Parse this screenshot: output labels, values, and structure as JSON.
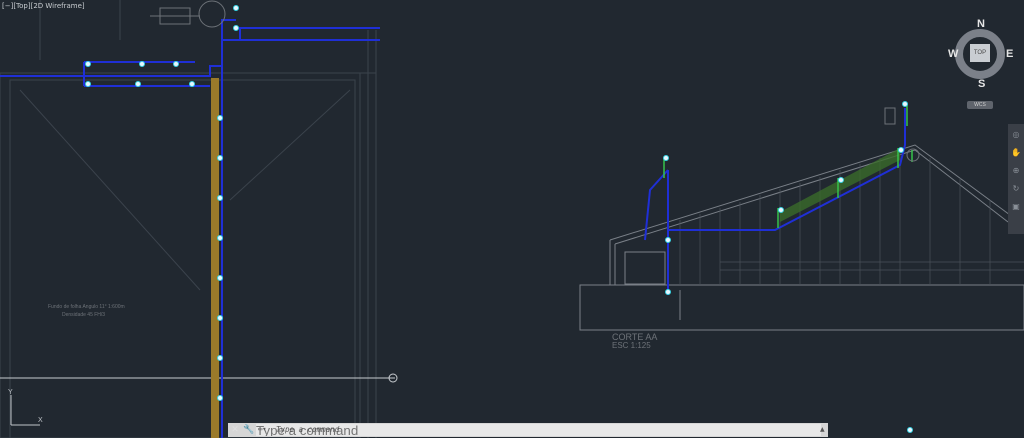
{
  "viewport": {
    "label": "[−][Top][2D Wireframe]"
  },
  "viewcube": {
    "north": "N",
    "south": "S",
    "east": "E",
    "west": "W",
    "face": "TOP",
    "ucs_menu": "WCS"
  },
  "ucs": {
    "x": "X",
    "y": "Y"
  },
  "drawing": {
    "section_title": "CORTE AA",
    "section_scale": "ESC 1:125",
    "note_line1": "Fundo de folha  Angulo 11°  1:600m",
    "note_line2": "Densidade 45 FH/3"
  },
  "command_line": {
    "close_icon": "close-icon",
    "customize_icon": "wrench-icon",
    "placeholder": "Type a command"
  },
  "colors": {
    "background": "#212830",
    "pipe": "#1f2fd6",
    "wood": "#9a7a2a",
    "hatch": "#7a8088",
    "accent_green": "#36c24a",
    "accent_cyan": "#39d6e6"
  }
}
